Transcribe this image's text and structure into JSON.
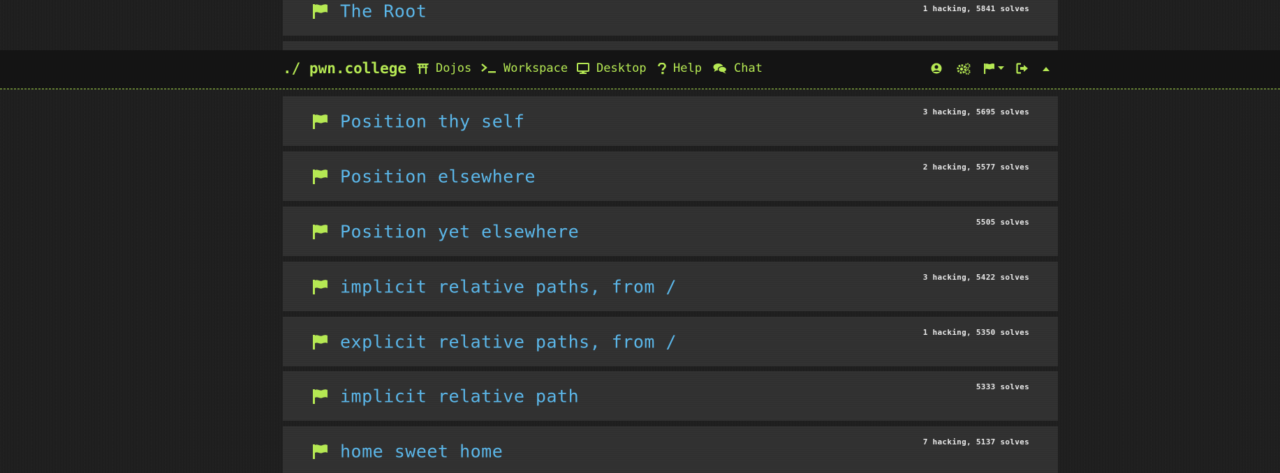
{
  "navbar": {
    "brand": "./ pwn.college",
    "items": [
      {
        "label": "Dojos",
        "icon": "torii-gate-icon"
      },
      {
        "label": "Workspace",
        "icon": "terminal-icon"
      },
      {
        "label": "Desktop",
        "icon": "desktop-icon"
      },
      {
        "label": "Help",
        "icon": "question-icon"
      },
      {
        "label": "Chat",
        "icon": "comments-icon"
      }
    ],
    "right_icons": [
      "user-circle-icon",
      "cogs-icon",
      "flag-dropdown-icon",
      "sign-out-icon",
      "caret-up-icon"
    ]
  },
  "challenges": [
    {
      "title": "The Root",
      "stats": "1 hacking, 5841 solves"
    },
    {
      "title": "Position thy self",
      "stats": "3 hacking, 5695 solves"
    },
    {
      "title": "Position elsewhere",
      "stats": "2 hacking, 5577 solves"
    },
    {
      "title": "Position yet elsewhere",
      "stats": "5505 solves"
    },
    {
      "title": "implicit relative paths, from /",
      "stats": "3 hacking, 5422 solves"
    },
    {
      "title": "explicit relative paths, from /",
      "stats": "1 hacking, 5350 solves"
    },
    {
      "title": "implicit relative path",
      "stats": "5333 solves"
    },
    {
      "title": "home sweet home",
      "stats": "7 hacking, 5137 solves"
    }
  ],
  "colors": {
    "accent": "#b5e853",
    "title": "#5bb6e8",
    "row_bg": "#303030",
    "page_bg": "#1e1e1e",
    "navbar_bg": "#141414"
  }
}
